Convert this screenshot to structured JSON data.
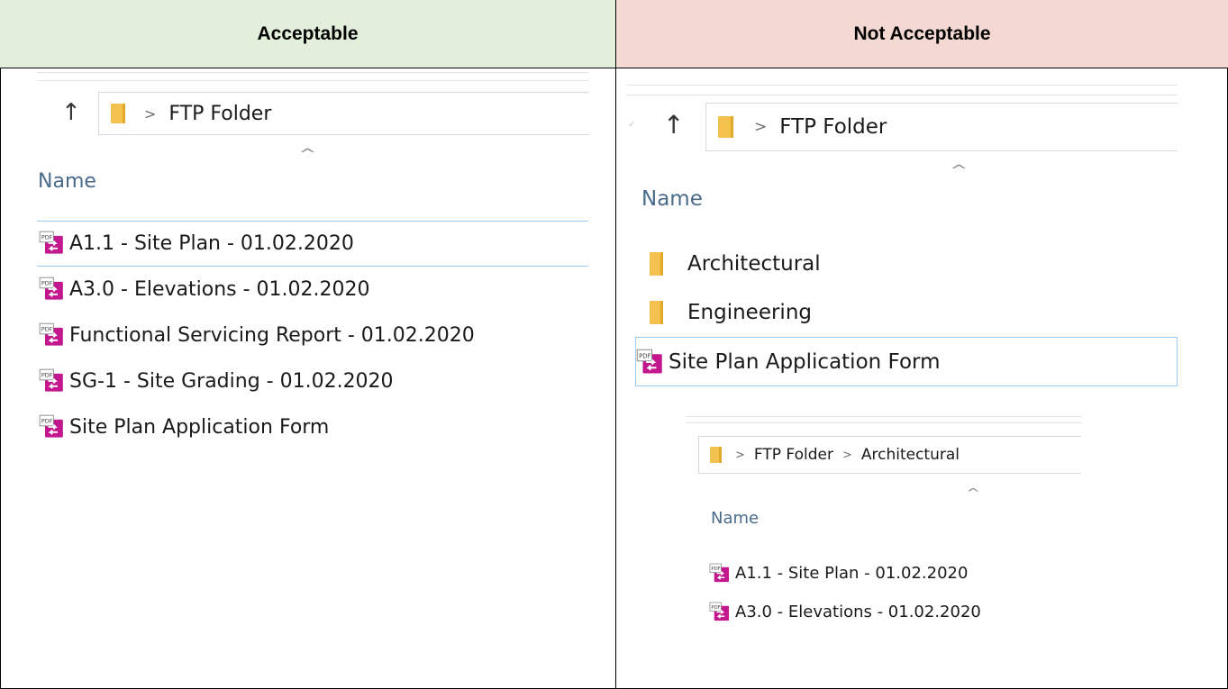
{
  "headers": {
    "acceptable": "Acceptable",
    "not_acceptable": "Not Acceptable",
    "acceptable_bg": "#e2efda",
    "not_acceptable_bg": "#f4d8d2"
  },
  "left": {
    "breadcrumb": [
      "FTP Folder"
    ],
    "column_header": "Name",
    "files": [
      "A1.1 - Site Plan - 01.02.2020",
      "A3.0 - Elevations - 01.02.2020",
      "Functional Servicing Report - 01.02.2020",
      "SG-1 - Site Grading - 01.02.2020",
      "Site Plan Application Form"
    ]
  },
  "right_top": {
    "breadcrumb": [
      "FTP Folder"
    ],
    "column_header": "Name",
    "folders": [
      "Architectural",
      "Engineering"
    ],
    "files": [
      "Site Plan Application Form"
    ]
  },
  "right_bottom": {
    "breadcrumb": [
      "FTP Folder",
      "Architectural"
    ],
    "column_header": "Name",
    "files": [
      "A1.1 - Site Plan - 01.02.2020",
      "A3.0 - Elevations - 01.02.2020"
    ]
  },
  "icons": {
    "up": "up-arrow-icon",
    "folder": "folder-icon",
    "pdf": "pdf-file-icon",
    "chevron": "chevron-right-icon",
    "sort": "sort-ascending-icon"
  }
}
